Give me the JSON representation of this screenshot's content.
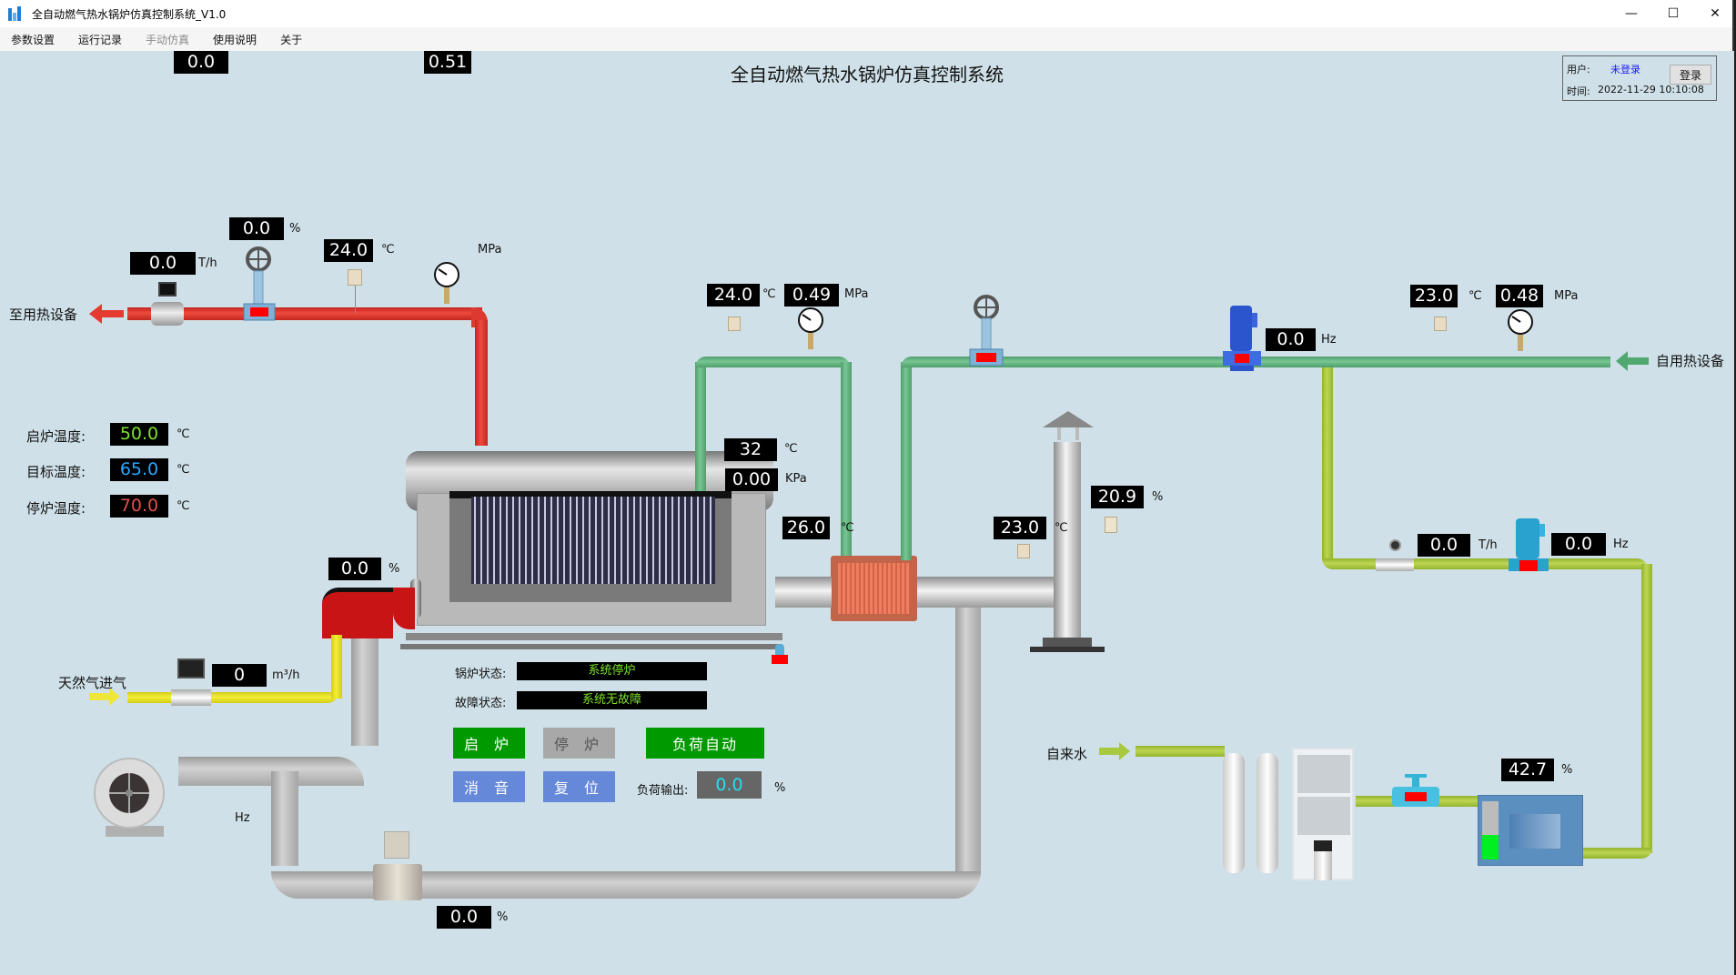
{
  "window": {
    "title": "全自动燃气热水锅炉仿真控制系统_V1.0",
    "minimize_icon": "minimize-icon",
    "maximize_icon": "maximize-icon",
    "close_icon": "close-icon",
    "min_glyph": "—",
    "max_glyph": "☐",
    "close_glyph": "✕"
  },
  "menu": [
    {
      "label": "参数设置",
      "enabled": true
    },
    {
      "label": "运行记录",
      "enabled": true
    },
    {
      "label": "手动仿真",
      "enabled": false
    },
    {
      "label": "使用说明",
      "enabled": true
    },
    {
      "label": "关于",
      "enabled": true
    }
  ],
  "header": {
    "title": "全自动燃气热水锅炉仿真控制系统",
    "user_label": "用户:",
    "user_value": "未登录",
    "time_label": "时间:",
    "time_value": "2022-11-29 10:10:08",
    "login_button": "登录"
  },
  "hot_supply": {
    "label": "至用热设备",
    "flow": {
      "value": "0.0",
      "unit": "T/h"
    },
    "valve_open": {
      "value": "0.0",
      "unit": "%"
    },
    "temp": {
      "value": "24.0",
      "unit": "℃"
    },
    "pressure": {
      "value": "0.51",
      "unit": "MPa"
    }
  },
  "temp_settings": {
    "start": {
      "label": "启炉温度:",
      "value": "50.0",
      "unit": "℃",
      "color": "#7ee22a"
    },
    "target": {
      "label": "目标温度:",
      "value": "65.0",
      "unit": "℃",
      "color": "#2aa8ff"
    },
    "stop": {
      "label": "停炉温度:",
      "value": "70.0",
      "unit": "℃",
      "color": "#e0504a"
    }
  },
  "burner": {
    "damper": {
      "value": "0.0",
      "unit": "%"
    }
  },
  "gas_inlet": {
    "label": "天然气进气",
    "flow": {
      "value": "0",
      "unit": "m³/h"
    }
  },
  "blower": {
    "freq": {
      "value": "0.0",
      "unit": "Hz"
    }
  },
  "recirc_damper": {
    "value": "0.0",
    "unit": "%"
  },
  "boiler": {
    "furnace_temp": {
      "value": "32",
      "unit": "℃"
    },
    "furnace_pressure": {
      "value": "0.00",
      "unit": "KPa"
    },
    "exhaust_temp": {
      "value": "26.0",
      "unit": "℃"
    }
  },
  "primary_loop": {
    "temp": {
      "value": "24.0",
      "unit": "℃"
    },
    "pressure": {
      "value": "0.49",
      "unit": "MPa"
    }
  },
  "flue": {
    "temp": {
      "value": "23.0",
      "unit": "℃"
    },
    "oxygen": {
      "value": "20.9",
      "unit": "%"
    }
  },
  "return_line": {
    "label": "自用热设备",
    "pump_freq": {
      "value": "0.0",
      "unit": "Hz"
    },
    "temp": {
      "value": "23.0",
      "unit": "℃"
    },
    "pressure": {
      "value": "0.48",
      "unit": "MPa"
    }
  },
  "makeup": {
    "flow": {
      "value": "0.0",
      "unit": "T/h"
    },
    "pump_freq": {
      "value": "0.0",
      "unit": "Hz"
    },
    "tank_level": {
      "value": "42.7",
      "unit": "%",
      "fraction": 0.427
    },
    "water_label": "自来水"
  },
  "status": {
    "boiler_label": "锅炉状态:",
    "boiler_value": "系统停炉",
    "fault_label": "故障状态:",
    "fault_value": "系统无故障"
  },
  "controls": {
    "start": "启 炉",
    "stop": "停 炉",
    "auto_load": "负荷自动",
    "mute": "消 音",
    "reset": "复 位",
    "load_output_label": "负荷输出:",
    "load_output_value": "0.0",
    "load_output_unit": "%",
    "colors": {
      "green": "#009900",
      "gray": "#a8a8a8",
      "blue": "#6688d8"
    }
  }
}
